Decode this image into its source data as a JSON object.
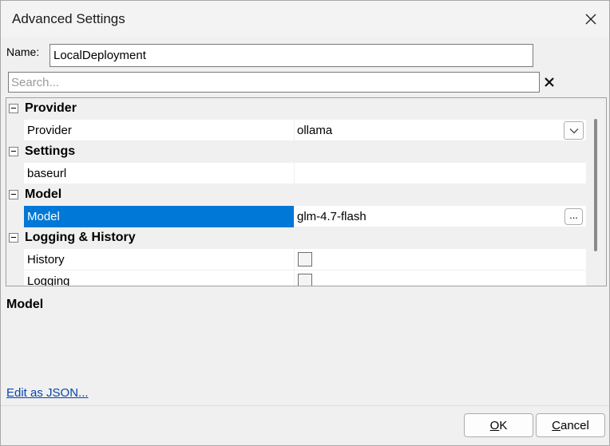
{
  "window": {
    "title": "Advanced Settings"
  },
  "name_field": {
    "label": "Name:",
    "value": "LocalDeployment"
  },
  "search": {
    "placeholder": "Search..."
  },
  "grid": {
    "categories": [
      {
        "label": "Provider"
      },
      {
        "label": "Settings"
      },
      {
        "label": "Model"
      },
      {
        "label": "Logging & History"
      }
    ],
    "properties": {
      "provider": {
        "name": "Provider",
        "value": "ollama"
      },
      "baseurl": {
        "name": "baseurl",
        "value": ""
      },
      "model": {
        "name": "Model",
        "value": "glm-4.7-flash",
        "selected": true
      },
      "history": {
        "name": "History",
        "checked": false
      },
      "logging": {
        "name": "Logging",
        "checked": false
      }
    },
    "ellipsis_glyph": "..."
  },
  "description": {
    "title": "Model"
  },
  "links": {
    "edit_json": "Edit as JSON..."
  },
  "buttons": {
    "ok": "OK",
    "cancel": "Cancel"
  },
  "colors": {
    "selection": "#0078d7",
    "link": "#0645ad"
  }
}
